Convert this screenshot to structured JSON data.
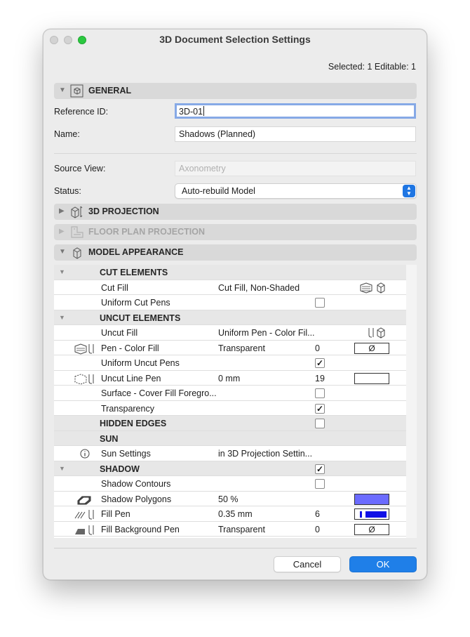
{
  "window": {
    "title": "3D Document Selection Settings"
  },
  "selection_info": "Selected: 1 Editable: 1",
  "sections": {
    "general": "GENERAL",
    "projection_3d": "3D PROJECTION",
    "floor_plan_projection": "FLOOR PLAN PROJECTION",
    "model_appearance": "MODEL APPEARANCE"
  },
  "general": {
    "reference_id_label": "Reference ID:",
    "reference_id_value": "3D-01",
    "name_label": "Name:",
    "name_value": "Shadows (Planned)",
    "source_view_label": "Source View:",
    "source_view_value": "Axonometry",
    "status_label": "Status:",
    "status_value": "Auto-rebuild Model"
  },
  "model_appearance": {
    "cut_elements": "CUT ELEMENTS",
    "cut_fill_label": "Cut Fill",
    "cut_fill_value": "Cut Fill, Non-Shaded",
    "uniform_cut_pens_label": "Uniform Cut Pens",
    "uniform_cut_pens_checked": false,
    "uncut_elements": "UNCUT ELEMENTS",
    "uncut_fill_label": "Uncut Fill",
    "uncut_fill_value": "Uniform Pen - Color Fil...",
    "pen_color_fill_label": "Pen - Color Fill",
    "pen_color_fill_value": "Transparent",
    "pen_color_fill_num": "0",
    "pen_color_fill_swatch": "Ø",
    "uniform_uncut_pens_label": "Uniform Uncut Pens",
    "uniform_uncut_pens_checked": true,
    "uncut_line_pen_label": "Uncut Line Pen",
    "uncut_line_pen_value": "0 mm",
    "uncut_line_pen_num": "19",
    "surface_cover_label": "Surface - Cover Fill Foregro...",
    "surface_cover_checked": false,
    "transparency_label": "Transparency",
    "transparency_checked": true,
    "hidden_edges": "HIDDEN EDGES",
    "hidden_edges_checked": false,
    "sun": "SUN",
    "sun_settings_label": "Sun Settings",
    "sun_settings_value": "in 3D Projection Settin...",
    "shadow": "SHADOW",
    "shadow_checked": true,
    "shadow_contours_label": "Shadow Contours",
    "shadow_contours_checked": false,
    "shadow_polygons_label": "Shadow Polygons",
    "shadow_polygons_value": "50 %",
    "shadow_polygons_color": "#6b6bff",
    "fill_pen_label": "Fill Pen",
    "fill_pen_value": "0.35 mm",
    "fill_pen_num": "6",
    "fill_pen_color": "#1010e6",
    "fill_bg_pen_label": "Fill Background Pen",
    "fill_bg_pen_value": "Transparent",
    "fill_bg_pen_num": "0",
    "fill_bg_pen_swatch": "Ø"
  },
  "buttons": {
    "cancel": "Cancel",
    "ok": "OK"
  },
  "check_glyph": "✓"
}
